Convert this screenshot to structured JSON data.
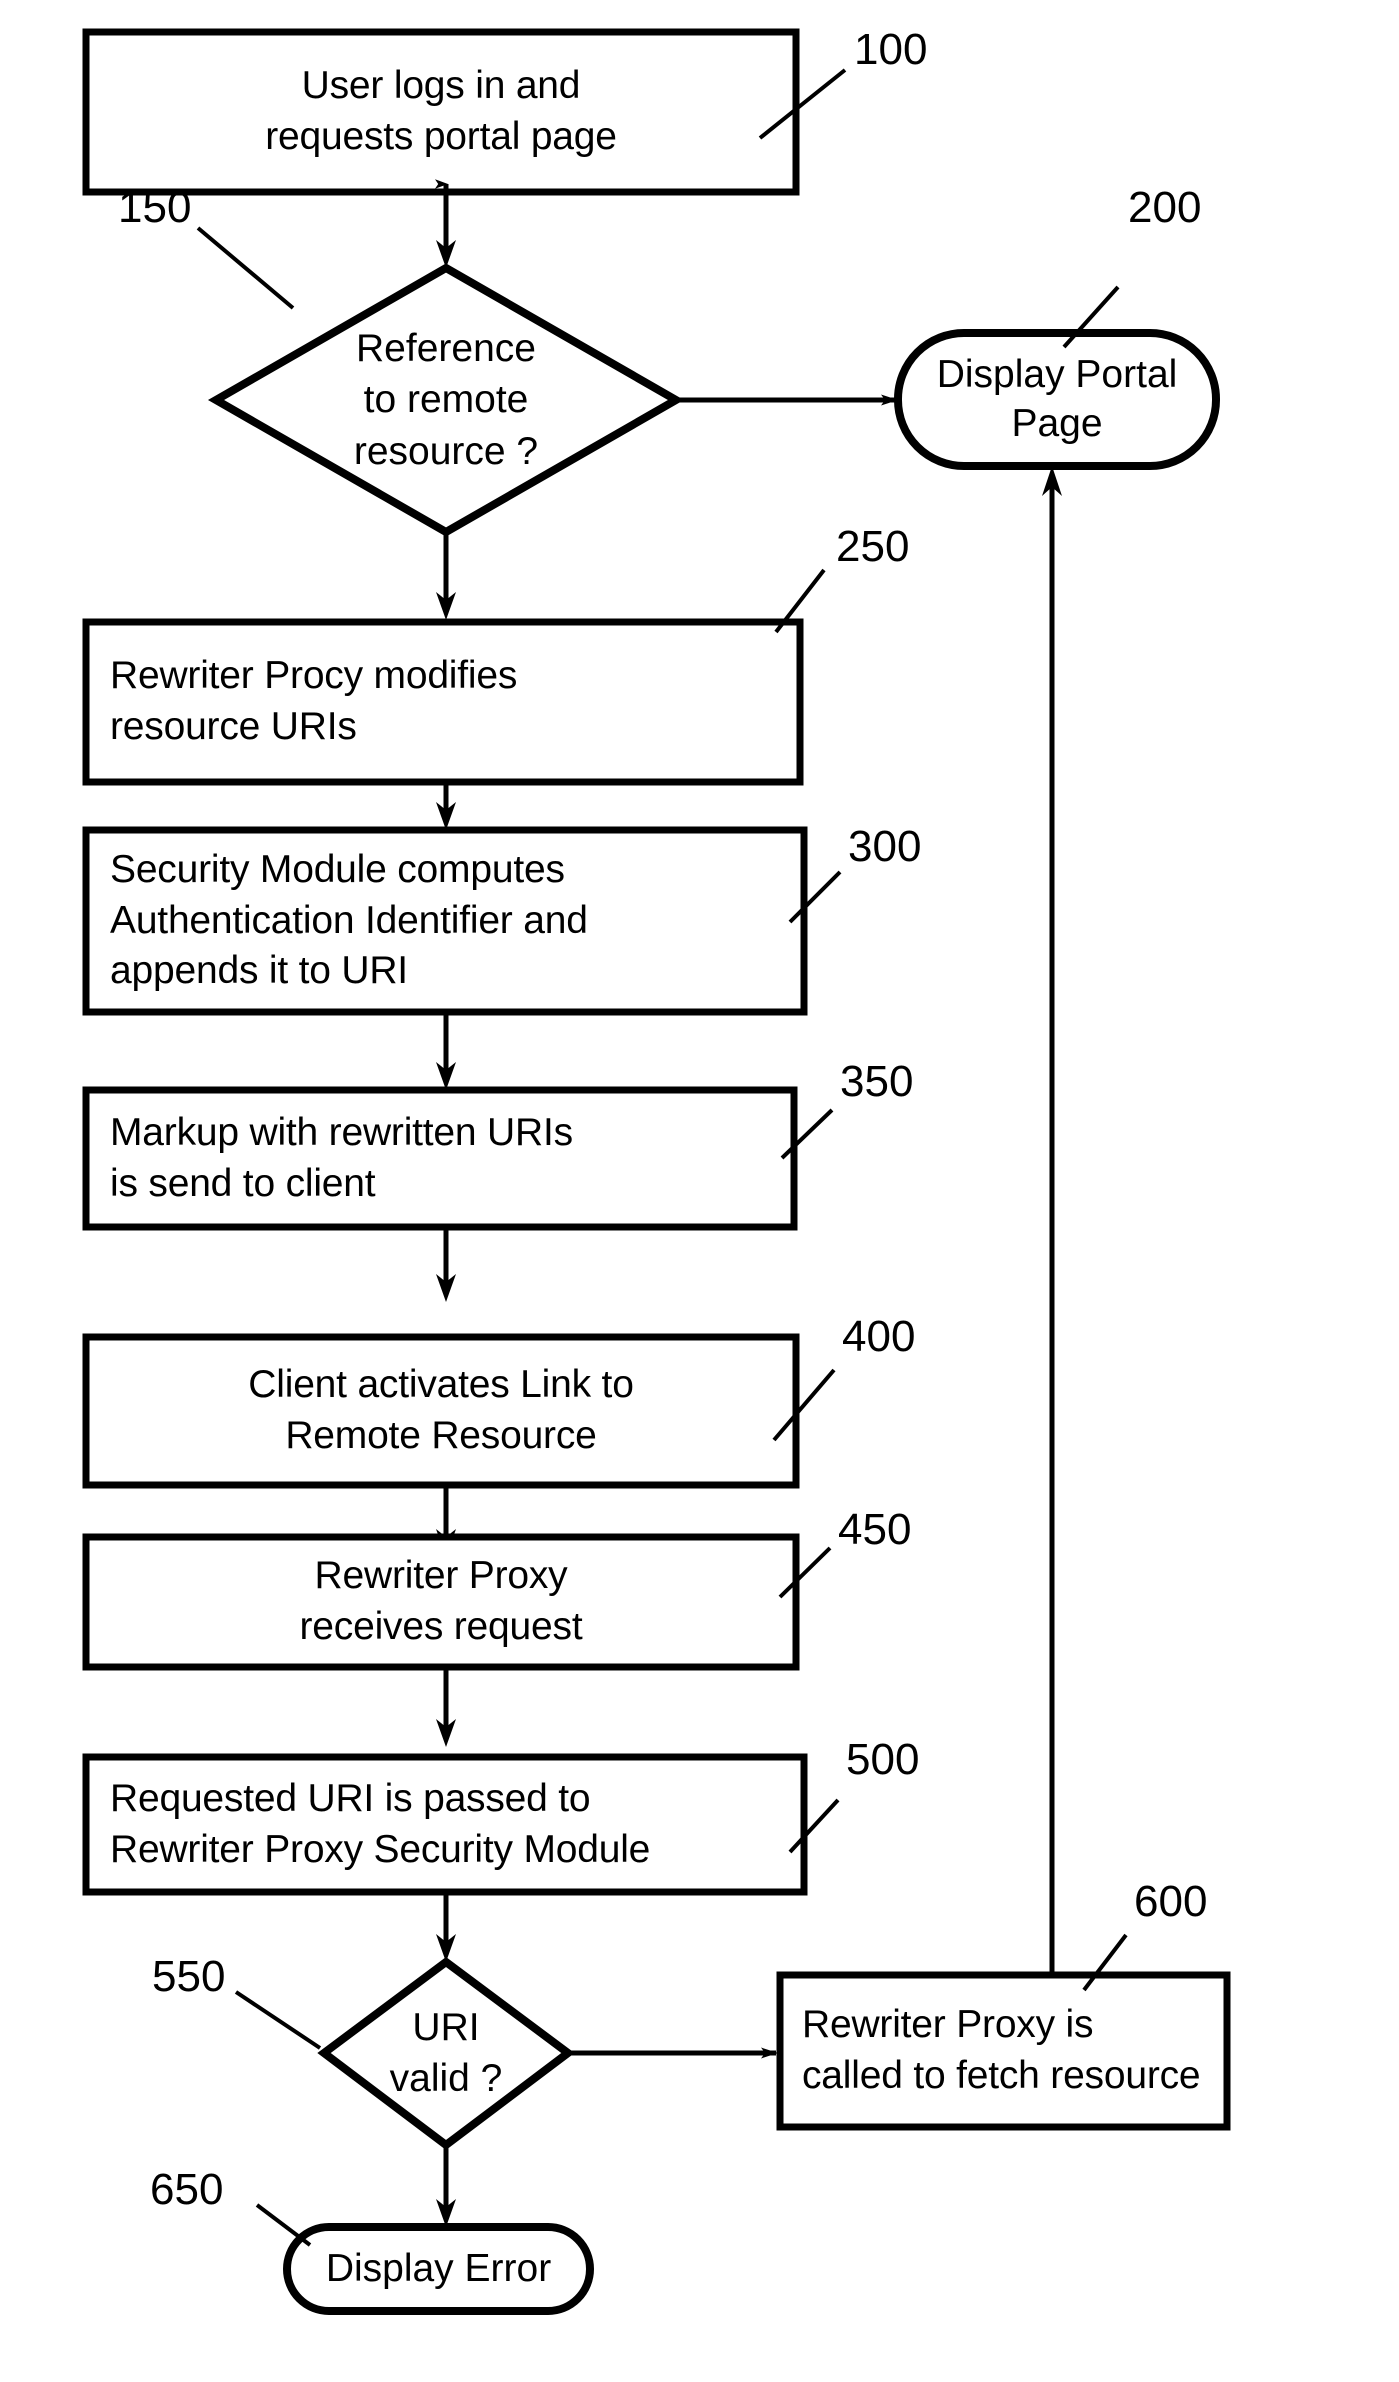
{
  "figure": {
    "type": "flowchart",
    "title": "",
    "stroke_color": "#000000",
    "background_color": "#ffffff",
    "text_color": "#000000"
  },
  "nodes": [
    {
      "ref": "100",
      "shape": "rectangle",
      "text": "User logs in and\nrequests portal page",
      "align": "center"
    },
    {
      "ref": "150",
      "shape": "diamond",
      "text": "Reference\nto remote\nresource ?",
      "align": "center"
    },
    {
      "ref": "200",
      "shape": "stadium",
      "text": "Display Portal\nPage",
      "align": "center"
    },
    {
      "ref": "250",
      "shape": "rectangle",
      "text": "Rewriter Procy modifies\nresource URIs",
      "align": "left"
    },
    {
      "ref": "300",
      "shape": "rectangle",
      "text": "Security Module computes\nAuthentication Identifier and\nappends it to URI",
      "align": "left"
    },
    {
      "ref": "350",
      "shape": "rectangle",
      "text": "Markup with rewritten URIs\nis send to client",
      "align": "left"
    },
    {
      "ref": "400",
      "shape": "rectangle",
      "text": "Client activates Link to\nRemote Resource",
      "align": "center"
    },
    {
      "ref": "450",
      "shape": "rectangle",
      "text": "Rewriter Proxy\nreceives request",
      "align": "center"
    },
    {
      "ref": "500",
      "shape": "rectangle",
      "text": "Requested URI is passed to\nRewriter Proxy Security Module",
      "align": "left"
    },
    {
      "ref": "550",
      "shape": "diamond",
      "text": "URI\nvalid ?",
      "align": "center"
    },
    {
      "ref": "600",
      "shape": "rectangle",
      "text": "Rewriter Proxy is\ncalled to fetch resource",
      "align": "left"
    },
    {
      "ref": "650",
      "shape": "stadium",
      "text": "Display Error",
      "align": "center"
    }
  ],
  "ref_numbers": {
    "n100": "100",
    "n150": "150",
    "n200": "200",
    "n250": "250",
    "n300": "300",
    "n350": "350",
    "n400": "400",
    "n450": "450",
    "n500": "500",
    "n550": "550",
    "n600": "600",
    "n650": "650"
  },
  "node_text": {
    "n100": "User logs in and\nrequests portal page",
    "n150": "Reference\nto remote\nresource ?",
    "n200": "Display Portal\nPage",
    "n250": "Rewriter Procy modifies\nresource URIs",
    "n300": "Security Module computes\nAuthentication Identifier and\nappends it to URI",
    "n350": "Markup with rewritten URIs\nis send to client",
    "n400": "Client activates Link to\nRemote Resource",
    "n450": "Rewriter Proxy\nreceives request",
    "n500": "Requested URI is passed to\nRewriter Proxy Security Module",
    "n550": "URI\nvalid ?",
    "n600": "Rewriter Proxy is\ncalled to fetch resource",
    "n650": "Display Error"
  },
  "edges": [
    {
      "from": "100",
      "to": "150",
      "direction": "down"
    },
    {
      "from": "150",
      "to": "200",
      "direction": "right"
    },
    {
      "from": "150",
      "to": "250",
      "direction": "down"
    },
    {
      "from": "250",
      "to": "300",
      "direction": "down"
    },
    {
      "from": "300",
      "to": "350",
      "direction": "down"
    },
    {
      "from": "350",
      "to": "400",
      "direction": "down"
    },
    {
      "from": "400",
      "to": "450",
      "direction": "down"
    },
    {
      "from": "450",
      "to": "500",
      "direction": "down"
    },
    {
      "from": "500",
      "to": "550",
      "direction": "down"
    },
    {
      "from": "550",
      "to": "600",
      "direction": "right"
    },
    {
      "from": "550",
      "to": "650",
      "direction": "down"
    },
    {
      "from": "600",
      "to": "200",
      "direction": "up"
    }
  ]
}
